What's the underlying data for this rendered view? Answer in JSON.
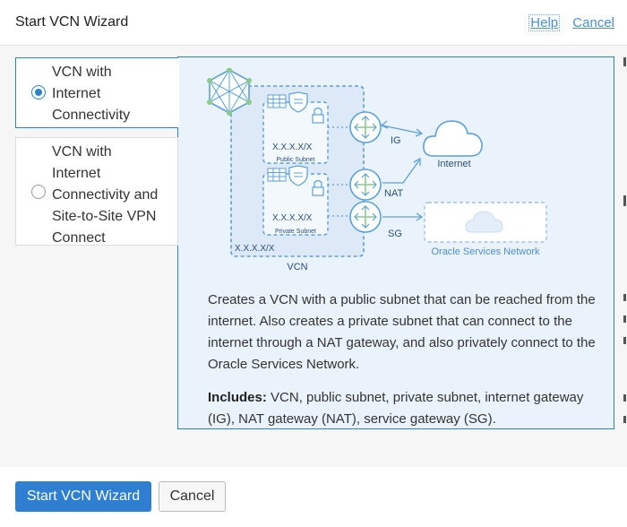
{
  "dialog": {
    "title": "Start VCN Wizard",
    "help_link": "Help",
    "cancel_link": "Cancel"
  },
  "options": [
    {
      "label": "VCN with Internet Connectivity",
      "lines": [
        "VCN with",
        "Internet",
        "Connectivity"
      ],
      "selected": true
    },
    {
      "label": "VCN with Internet Connectivity and Site-to-Site VPN Connect",
      "lines": [
        "VCN with",
        "Internet",
        "Connectivity and",
        "Site-to-Site VPN",
        "Connect"
      ],
      "selected": false
    }
  ],
  "diagram": {
    "public_cidr": "X.X.X.X/X",
    "public_subnet_label": "Public Subnet",
    "private_cidr": "X.X.X.X/X",
    "private_subnet_label": "Private Subnet",
    "vcn_cidr": "X.X.X.X/X",
    "vcn_label": "VCN",
    "ig_label": "IG",
    "nat_label": "NAT",
    "sg_label": "SG",
    "internet_label": "Internet",
    "osn_label": "Oracle Services Network"
  },
  "description": "Creates a VCN with a public subnet that can be reached from the internet. Also creates a private subnet that can connect to the internet through a NAT gateway, and also privately connect to the Oracle Services Network.",
  "includes": {
    "label": "Includes:",
    "text": " VCN, public subnet, private subnet, internet gateway (IG), NAT gateway (NAT), service gateway (SG)."
  },
  "footer": {
    "primary": "Start VCN Wizard",
    "cancel": "Cancel"
  },
  "colors": {
    "accent": "#2e7fd2",
    "panel_bg": "#eaf3fb",
    "diagram_line": "#5aa0dc",
    "diagram_green": "#8cc98a"
  }
}
